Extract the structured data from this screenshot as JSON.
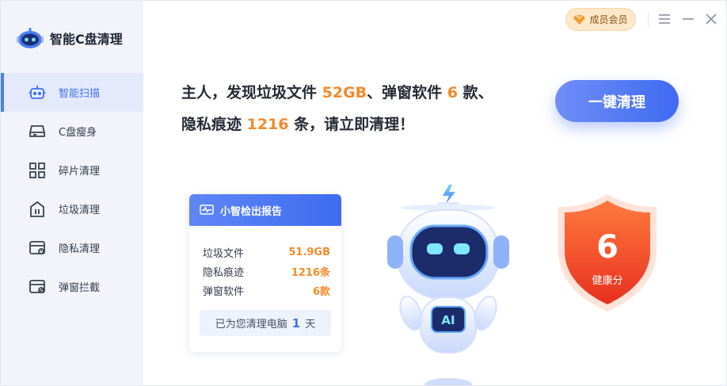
{
  "app": {
    "name": "智能C盘清理"
  },
  "sidebar": {
    "items": [
      {
        "label": "智能扫描",
        "icon": "robot-scan-icon",
        "active": true
      },
      {
        "label": "C盘瘦身",
        "icon": "disk-icon",
        "active": false
      },
      {
        "label": "碎片清理",
        "icon": "grid-fragments-icon",
        "active": false
      },
      {
        "label": "垃圾清理",
        "icon": "trash-bin-icon",
        "active": false
      },
      {
        "label": "隐私清理",
        "icon": "privacy-browser-icon",
        "active": false
      },
      {
        "label": "弹窗拦截",
        "icon": "popup-block-icon",
        "active": false
      }
    ]
  },
  "header": {
    "member_label": "成员会员",
    "controls": [
      "menu-icon",
      "minimize-icon",
      "close-icon"
    ]
  },
  "headline": {
    "line1_pre": "主人，发现垃圾文件 ",
    "junk_size": "52GB",
    "line1_mid": "、弹窗软件 ",
    "popup_count": "6",
    "line1_post": " 款、",
    "line2_pre": "隐私痕迹 ",
    "privacy_count": "1216",
    "line2_post": " 条，请立即清理！"
  },
  "clean_button": {
    "label": "一键清理"
  },
  "report": {
    "title": "小智检出报告",
    "rows": [
      {
        "label": "垃圾文件",
        "value": "51.9GB"
      },
      {
        "label": "隐私痕迹",
        "value": "1216条"
      },
      {
        "label": "弹窗软件",
        "value": "6款"
      }
    ],
    "footer_pre": "已为您清理电脑",
    "days": "1",
    "footer_post": "天"
  },
  "mascot": {
    "badge_text": "AI"
  },
  "health": {
    "score": "6",
    "label": "健康分"
  },
  "colors": {
    "accent": "#3f6ef2",
    "highlight": "#f48a2b",
    "shield": "#f04a2c"
  }
}
